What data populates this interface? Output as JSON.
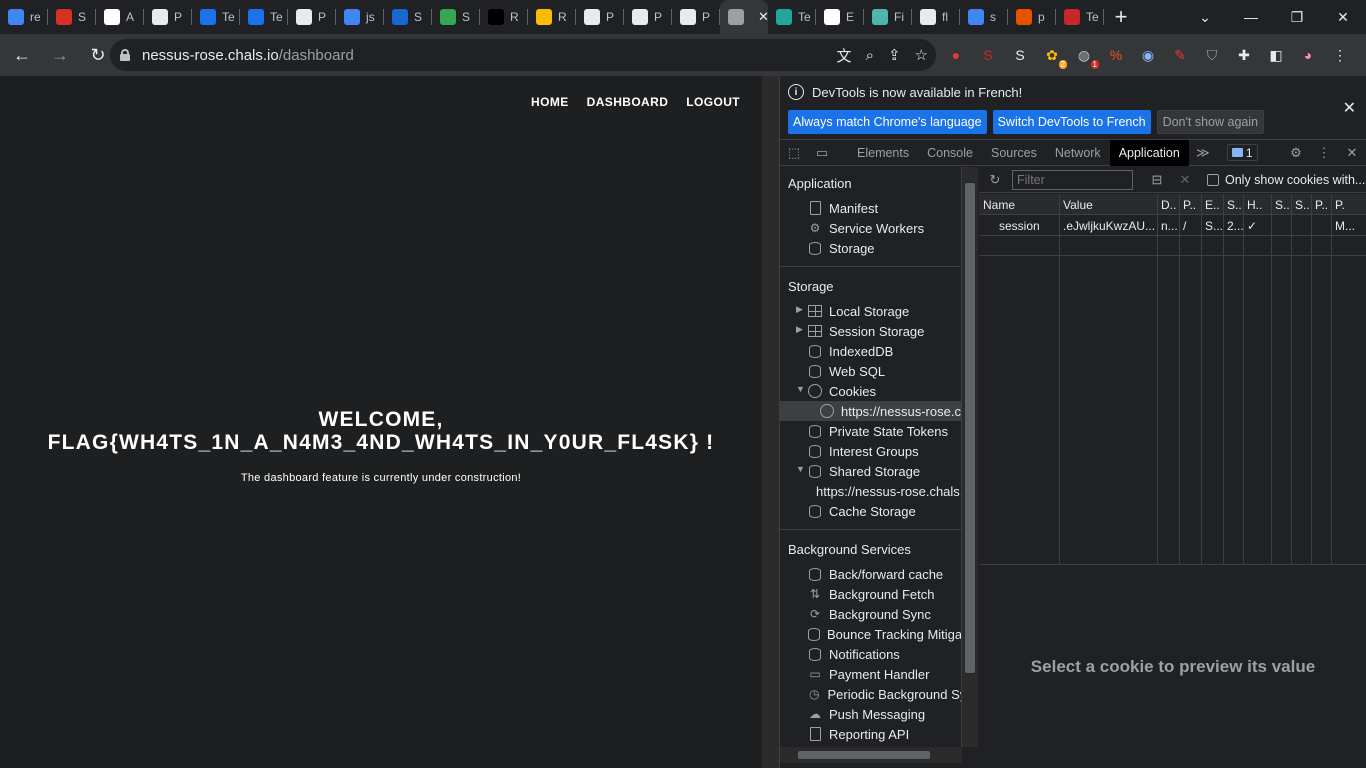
{
  "tabs": [
    {
      "label": "re",
      "color": "#4285f4"
    },
    {
      "label": "S",
      "color": "#d93025"
    },
    {
      "label": "A",
      "color": "#ffffff"
    },
    {
      "label": "P",
      "color": "#e8eaed"
    },
    {
      "label": "Te",
      "color": "#1a73e8"
    },
    {
      "label": "Te",
      "color": "#1a73e8"
    },
    {
      "label": "P",
      "color": "#e8eaed"
    },
    {
      "label": "js",
      "color": "#4285f4"
    },
    {
      "label": "S",
      "color": "#1967d2"
    },
    {
      "label": "S",
      "color": "#34a853"
    },
    {
      "label": "R",
      "color": "#000000"
    },
    {
      "label": "R",
      "color": "#fbbc04"
    },
    {
      "label": "P",
      "color": "#e8eaed"
    },
    {
      "label": "P",
      "color": "#e8eaed"
    },
    {
      "label": "P",
      "color": "#e8eaed"
    },
    {
      "label": "",
      "color": "#9aa0a6",
      "active": true,
      "close": "✕"
    },
    {
      "label": "Te",
      "color": "#26a69a"
    },
    {
      "label": "E",
      "color": "#ffffff"
    },
    {
      "label": "Fi",
      "color": "#4db6ac"
    },
    {
      "label": "fl",
      "color": "#e8eaed"
    },
    {
      "label": "s",
      "color": "#4285f4"
    },
    {
      "label": "p",
      "color": "#e65100"
    },
    {
      "label": "Te",
      "color": "#c62828"
    }
  ],
  "newtab_label": "+",
  "window": {
    "chevron": "⌄",
    "minimize": "—",
    "restore": "❐",
    "close": "✕"
  },
  "toolbar": {
    "back": "←",
    "forward": "→",
    "reload": "↻",
    "url_host": "nessus-rose.chals.io",
    "url_path": "/dashboard",
    "icons": [
      "translate-icon",
      "zoom-icon",
      "share-icon",
      "bookmark-star-icon"
    ],
    "icon_glyphs": [
      "文",
      "⌕",
      "⇪",
      "☆"
    ],
    "extensions": [
      {
        "name": "ublock-icon",
        "glyph": "●",
        "color": "#e53935"
      },
      {
        "name": "s-ext-icon",
        "glyph": "S",
        "color": "#c62828"
      },
      {
        "name": "s-round-ext-icon",
        "glyph": "S",
        "color": "#e8eaed"
      },
      {
        "name": "cookie-ext-icon",
        "glyph": "✿",
        "color": "#fbbc04",
        "badge": "2"
      },
      {
        "name": "globe-ext-icon",
        "glyph": "◍",
        "color": "#bdc1c6",
        "badge": "1"
      },
      {
        "name": "zoom-ext-icon",
        "glyph": "%",
        "color": "#f4511e"
      },
      {
        "name": "spy-ext-icon",
        "glyph": "◉",
        "color": "#8ab4f8"
      },
      {
        "name": "wand-ext-icon",
        "glyph": "✎",
        "color": "#e53935"
      },
      {
        "name": "shield-ext-icon",
        "glyph": "⛉",
        "color": "#9aa0a6"
      },
      {
        "name": "puzzle-icon",
        "glyph": "✚",
        "color": "#e8eaed"
      },
      {
        "name": "sidepanel-icon",
        "glyph": "◧",
        "color": "#e8eaed"
      },
      {
        "name": "profile-avatar",
        "glyph": "◕",
        "color": "#f48fb1"
      },
      {
        "name": "menu-icon",
        "glyph": "⋮",
        "color": "#e8eaed"
      }
    ]
  },
  "page": {
    "nav": [
      "HOME",
      "DASHBOARD",
      "LOGOUT"
    ],
    "welcome_line1": "WELCOME,",
    "welcome_line2": "FLAG{WH4TS_1N_A_N4M3_4ND_WH4TS_IN_Y0UR_FL4SK} !",
    "subtitle": "The dashboard feature is currently under construction!"
  },
  "devtools": {
    "infobar": {
      "message": "DevTools is now available in French!",
      "btn_match": "Always match Chrome's language",
      "btn_switch": "Switch DevTools to French",
      "btn_dismiss": "Don't show again",
      "close": "✕"
    },
    "tabs": [
      "Elements",
      "Console",
      "Sources",
      "Network",
      "Application"
    ],
    "active_tab": "Application",
    "more_tabs": "≫",
    "issues_count": "1",
    "sidebar": {
      "application_title": "Application",
      "application_items": [
        "Manifest",
        "Service Workers",
        "Storage"
      ],
      "storage_title": "Storage",
      "storage_items": [
        "Local Storage",
        "Session Storage",
        "IndexedDB",
        "Web SQL",
        "Cookies"
      ],
      "cookie_origin": "https://nessus-rose.chals.io",
      "storage_items2": [
        "Private State Tokens",
        "Interest Groups",
        "Shared Storage"
      ],
      "shared_storage_origin": "https://nessus-rose.chals.io",
      "cache_storage": "Cache Storage",
      "background_title": "Background Services",
      "background_items": [
        "Back/forward cache",
        "Background Fetch",
        "Background Sync",
        "Bounce Tracking Mitigations",
        "Notifications",
        "Payment Handler",
        "Periodic Background Sync",
        "Push Messaging",
        "Reporting API"
      ]
    },
    "cookies": {
      "filter_placeholder": "Filter",
      "only_issues": "Only show cookies with...",
      "columns": [
        "Name",
        "Value",
        "D..",
        "P..",
        "E..",
        "S..",
        "H..",
        "S..",
        "S..",
        "P..",
        "P."
      ],
      "rows": [
        [
          "session",
          ".eJwljkuKwzAU...",
          "n...",
          "/",
          "S...",
          "2...",
          "✓",
          "",
          "",
          "",
          "M..."
        ]
      ],
      "preview_text": "Select a cookie to preview its value"
    }
  }
}
